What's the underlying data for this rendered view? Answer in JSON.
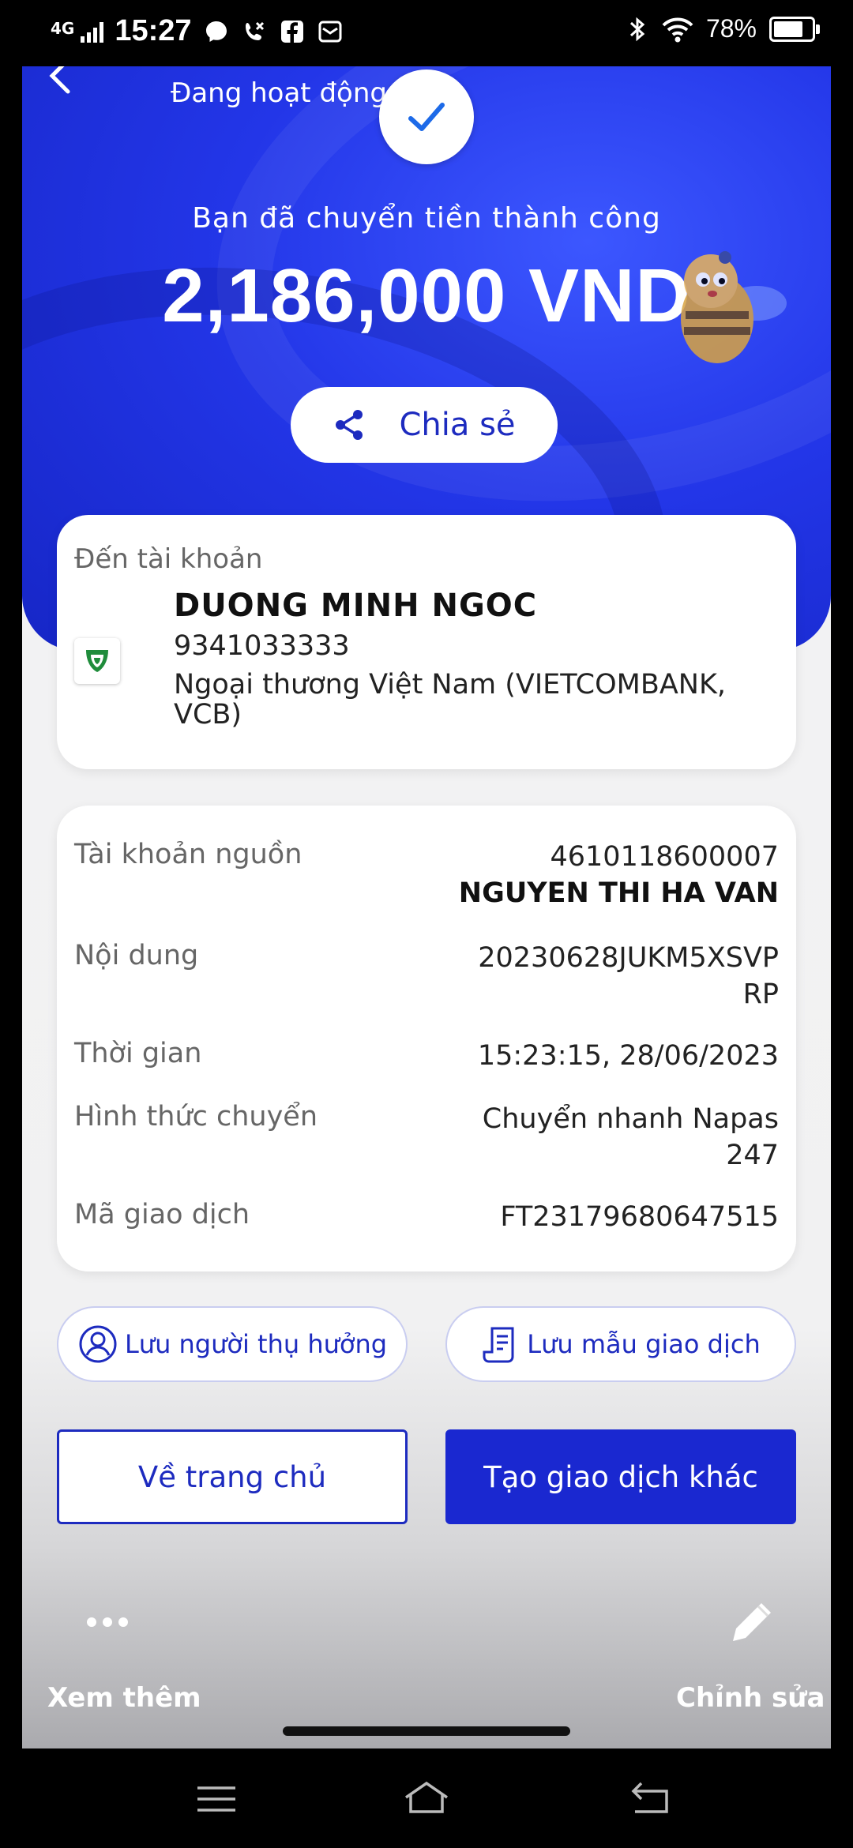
{
  "status_bar": {
    "network": "4G",
    "time": "15:27",
    "battery": "78%",
    "battery_level": 0.78
  },
  "header": {
    "status": "Đang hoạt động"
  },
  "hero": {
    "success_message": "Bạn đã chuyển tiền thành công",
    "amount": "2,186,000 VND",
    "share_label": "Chia sẻ"
  },
  "destination": {
    "label": "Đến tài khoản",
    "name": "DUONG MINH NGOC",
    "account": "9341033333",
    "bank": "Ngoại thương Việt Nam (VIETCOMBANK, VCB)"
  },
  "details": [
    {
      "label": "Tài khoản nguồn",
      "value": "4610118600007",
      "value2": "NGUYEN THI HA VAN"
    },
    {
      "label": "Nội dung",
      "value": "20230628JUKM5XSVP",
      "value2": "RP"
    },
    {
      "label": "Thời gian",
      "value": "15:23:15, 28/06/2023"
    },
    {
      "label": "Hình thức chuyển",
      "value": "Chuyển nhanh Napas",
      "value2": "247"
    },
    {
      "label": "Mã giao dịch",
      "value": "FT23179680647515"
    }
  ],
  "actions": {
    "save_payee": "Lưu người thụ hưởng",
    "save_template": "Lưu mẫu giao dịch",
    "home": "Về trang chủ",
    "new_transaction": "Tạo giao dịch khác"
  },
  "overlay": {
    "more": "Xem thêm",
    "edit": "Chỉnh sửa"
  },
  "colors": {
    "primary": "#1a28d0",
    "hero": "#2336e8",
    "background": "#f3f3f4"
  }
}
